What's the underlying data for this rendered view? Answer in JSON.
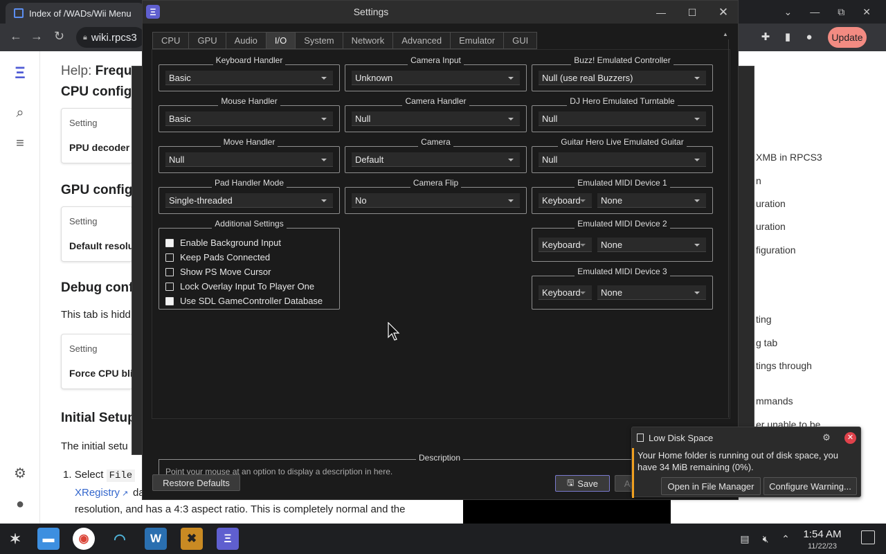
{
  "browser": {
    "tab_title": "Index of /WADs/Wii Menu",
    "url": "wiki.rpcs3",
    "update_label": "Update",
    "ctrl_chevron": "⌄",
    "ctrl_min": "—",
    "ctrl_max": "⧉",
    "ctrl_close": "✕"
  },
  "wiki": {
    "heading_help_prefix": "Help:",
    "heading_help_word": "Frequ",
    "cpu_heading": "CPU configu",
    "gpu_heading": "GPU configu",
    "debug_heading": "Debug confi",
    "debug_text": "This tab is hidd",
    "initial_heading": "Initial Setup",
    "initial_text": "The initial setu",
    "step_number": "1.",
    "step_select": "Select",
    "step_file": "File",
    "step_tail": "da",
    "step_link": "XRegistry",
    "resolution_text": "resolution, and has a 4:3 aspect ratio. This is completely normal and the",
    "cards": [
      {
        "head": "Setting",
        "value": "PPU decoder"
      },
      {
        "head": "Setting",
        "value": "Default resolu"
      },
      {
        "head": "Setting",
        "value": "Force CPU blit"
      }
    ],
    "toc": [
      "XMB in RPCS3",
      "n",
      "uration",
      "uration",
      "figuration",
      "ting",
      "g tab",
      "tings through",
      "mmands",
      "er unable to be"
    ]
  },
  "dialog": {
    "title": "Settings",
    "tabs": [
      "CPU",
      "GPU",
      "Audio",
      "I/O",
      "System",
      "Network",
      "Advanced",
      "Emulator",
      "GUI"
    ],
    "active_tab": "I/O",
    "groups": {
      "keyboard_handler": {
        "title": "Keyboard Handler",
        "value": "Basic"
      },
      "camera_input": {
        "title": "Camera Input",
        "value": "Unknown"
      },
      "buzz_controller": {
        "title": "Buzz! Emulated Controller",
        "value": "Null (use real Buzzers)"
      },
      "mouse_handler": {
        "title": "Mouse Handler",
        "value": "Basic"
      },
      "camera_handler": {
        "title": "Camera Handler",
        "value": "Null"
      },
      "dj_hero_turntable": {
        "title": "DJ Hero Emulated Turntable",
        "value": "Null"
      },
      "move_handler": {
        "title": "Move Handler",
        "value": "Null"
      },
      "camera": {
        "title": "Camera",
        "value": "Default"
      },
      "guitar_hero_live": {
        "title": "Guitar Hero Live Emulated Guitar",
        "value": "Null"
      },
      "pad_handler_mode": {
        "title": "Pad Handler Mode",
        "value": "Single-threaded"
      },
      "camera_flip": {
        "title": "Camera Flip",
        "value": "No"
      },
      "midi_1": {
        "title": "Emulated MIDI Device 1",
        "type": "Keyboard",
        "device": "None"
      },
      "midi_2": {
        "title": "Emulated MIDI Device 2",
        "type": "Keyboard",
        "device": "None"
      },
      "midi_3": {
        "title": "Emulated MIDI Device 3",
        "type": "Keyboard",
        "device": "None"
      }
    },
    "additional": {
      "title": "Additional Settings",
      "items": [
        {
          "label": "Enable Background Input",
          "checked": false
        },
        {
          "label": "Keep Pads Connected",
          "checked": false
        },
        {
          "label": "Show PS Move Cursor",
          "checked": false
        },
        {
          "label": "Lock Overlay Input To Player One",
          "checked": false
        },
        {
          "label": "Use SDL GameController Database",
          "checked": false
        }
      ]
    },
    "description": {
      "title": "Description",
      "text": "Point your mouse at an option to display a description in here."
    },
    "restore_label": "Restore Defaults",
    "save_label": "Save",
    "apply_label": "Apply"
  },
  "notification": {
    "title": "Low Disk Space",
    "body": "Your Home folder is running out of disk space, you have 34 MiB remaining (0%).",
    "open_label": "Open in File Manager",
    "configure_label": "Configure Warning...",
    "accent_color": "#f0a020"
  },
  "taskbar": {
    "time": "1:54 AM",
    "date": "11/22/23",
    "rpcs3_icon": "Ξ"
  },
  "colors": {
    "dialog_bg": "#1b1b1b",
    "update_button": "#f28b82",
    "close_red": "#e0424b",
    "rpcs3_purple": "#5f5fcf"
  }
}
